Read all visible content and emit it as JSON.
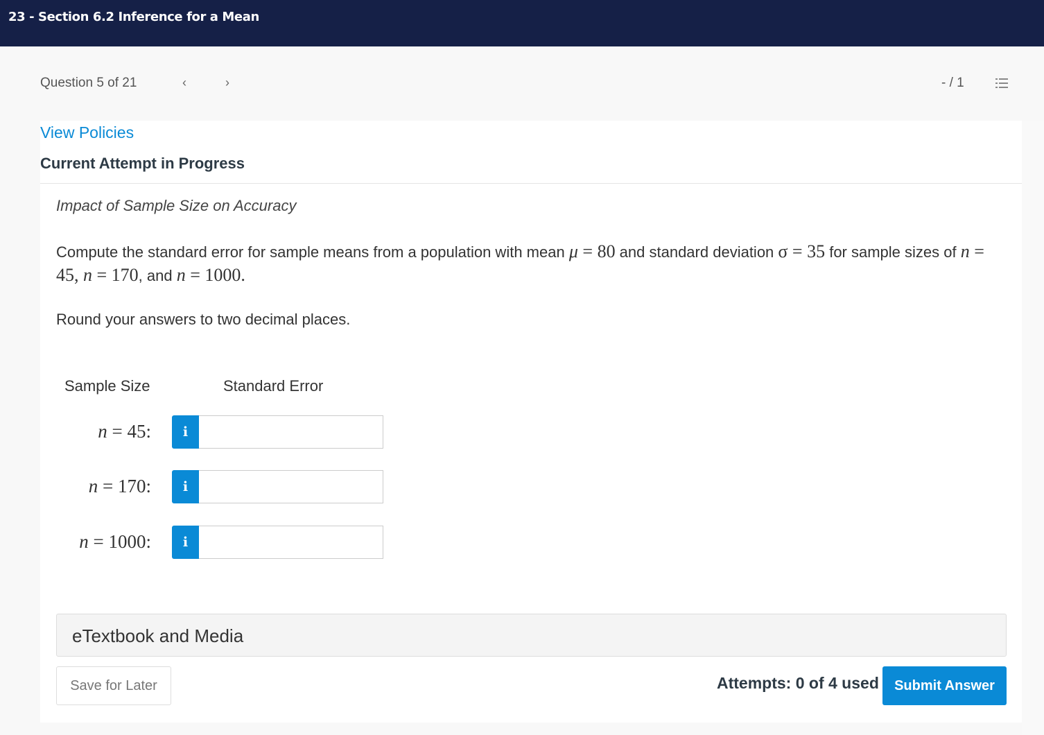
{
  "header": {
    "title": "23 - Section 6.2 Inference for a Mean"
  },
  "question_nav": {
    "counter": "Question 5 of 21",
    "prev_icon": "chevron-left-icon",
    "prev_glyph": "‹",
    "next_icon": "chevron-right-icon",
    "next_glyph": "›",
    "score": "- / 1",
    "list_icon": "numbered-list-icon"
  },
  "content": {
    "view_policies": "View Policies",
    "attempt_status": "Current Attempt in Progress",
    "subtitle": "Impact of Sample Size on Accuracy",
    "prompt": {
      "text1": "Compute the standard error for sample means from a population with mean ",
      "mu_sym": "μ",
      "eq": " = ",
      "mu_val": "80",
      "text2": " and standard deviation ",
      "sigma_sym": "σ",
      "sigma_val": "35",
      "text3": " for sample sizes of ",
      "n_sym": "n",
      "n1": "45",
      "comma": ", ",
      "n2": "170",
      "text4": ", and ",
      "n3": "1000",
      "period": "."
    },
    "round_note": "Round your answers to two decimal places.",
    "table": {
      "col_sample_size": "Sample Size",
      "col_standard_error": "Standard Error",
      "rows": [
        {
          "n_sym": "n",
          "eq": " = ",
          "value": "45",
          "colon": ":",
          "answer": "",
          "info_glyph": "i"
        },
        {
          "n_sym": "n",
          "eq": " = ",
          "value": "170",
          "colon": ":",
          "answer": "",
          "info_glyph": "i"
        },
        {
          "n_sym": "n",
          "eq": " = ",
          "value": "1000",
          "colon": ":",
          "answer": "",
          "info_glyph": "i"
        }
      ]
    },
    "etextbook": "eTextbook and Media",
    "save_label": "Save for Later",
    "attempts": "Attempts: 0 of 4 used",
    "submit_label": "Submit Answer"
  },
  "colors": {
    "header_bg": "#152047",
    "accent_blue": "#0a8ad6",
    "page_bg": "#f8f8f8"
  }
}
